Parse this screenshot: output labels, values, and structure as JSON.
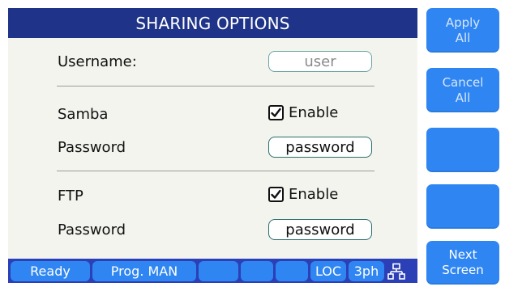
{
  "title": "SHARING OPTIONS",
  "form": {
    "username_label": "Username:",
    "username_value": "user",
    "samba_label": "Samba",
    "samba_enable_label": "Enable",
    "samba_enabled": true,
    "samba_password_label": "Password",
    "samba_password_value": "password",
    "ftp_label": "FTP",
    "ftp_enable_label": "Enable",
    "ftp_enabled": true,
    "ftp_password_label": "Password",
    "ftp_password_value": "password"
  },
  "softkeys": {
    "apply_line1": "Apply",
    "apply_line2": "All",
    "cancel_line1": "Cancel",
    "cancel_line2": "All",
    "next_line1": "Next",
    "next_line2": "Screen"
  },
  "status": {
    "ready": "Ready",
    "program": "Prog. MAN",
    "loc": "LOC",
    "phase": "3ph",
    "network_icon": "network-icon"
  },
  "colors": {
    "title_bg": "#1f3488",
    "softkey_bg": "#2f86f2",
    "statusbar_bg": "#2b3fb6",
    "panel_bg": "#f4f4ef"
  }
}
